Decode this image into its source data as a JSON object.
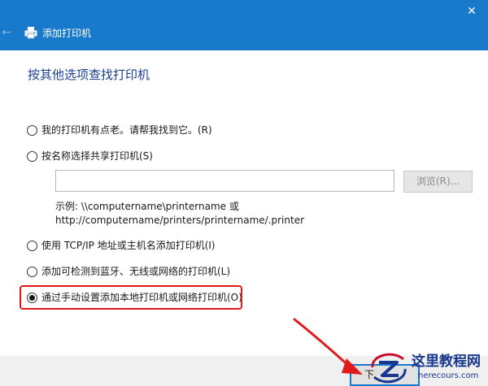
{
  "window": {
    "title": "添加打印机",
    "close_glyph": "✕",
    "back_glyph": "←",
    "accent_color": "#1979ca"
  },
  "main": {
    "heading": "按其他选项查找打印机",
    "options": [
      {
        "label": "我的打印机有点老。请帮我找到它。(R)",
        "checked": false
      },
      {
        "label": "按名称选择共享打印机(S)",
        "checked": false
      },
      {
        "label": "使用 TCP/IP 地址或主机名添加打印机(I)",
        "checked": false
      },
      {
        "label": "添加可检测到蓝牙、无线或网络的打印机(L)",
        "checked": false
      },
      {
        "label": "通过手动设置添加本地打印机或网络打印机(O)",
        "checked": true
      }
    ],
    "shared_printer": {
      "value": "",
      "browse_label": "浏览(R)...",
      "example_line1": "示例: \\\\computername\\printername 或",
      "example_line2": "http://computername/printers/printername/.printer"
    }
  },
  "footer": {
    "next_label": "下"
  },
  "watermark": {
    "title": "这里教程网",
    "url": "herecours.com"
  },
  "colors": {
    "highlight": "#e0191b",
    "heading": "#1a3f8f",
    "footer_bg": "#f0f0f0"
  }
}
